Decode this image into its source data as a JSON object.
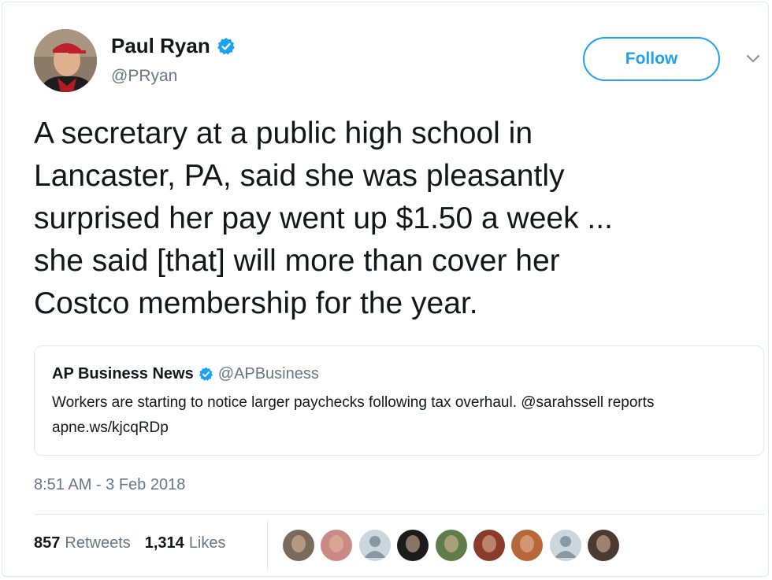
{
  "user": {
    "name": "Paul Ryan",
    "handle": "@PRyan",
    "follow_label": "Follow"
  },
  "tweet": {
    "text": "A secretary at a public high school in\nLancaster, PA, said she was pleasantly\nsurprised her pay went up $1.50 a week ...\nshe said [that] will more than cover her\nCostco membership for the year.",
    "timestamp": "8:51 AM - 3 Feb 2018"
  },
  "quoted": {
    "name": "AP Business News",
    "handle": "@APBusiness",
    "text": "Workers are starting to notice larger paychecks following tax overhaul. @sarahssell reports apne.ws/kjcqRDp"
  },
  "stats": {
    "retweets": "857",
    "retweets_label": "Retweets",
    "likes": "1,314",
    "likes_label": "Likes"
  },
  "likers": [
    {
      "icon": "liker-avatar-photo",
      "color": "#7a6a5c"
    },
    {
      "icon": "liker-avatar-photo",
      "color": "#c98a86"
    },
    {
      "icon": "liker-avatar-default",
      "color": "#ccd6dd"
    },
    {
      "icon": "liker-avatar-photo",
      "color": "#1b1b1b"
    },
    {
      "icon": "liker-avatar-photo",
      "color": "#5f7d4a"
    },
    {
      "icon": "liker-avatar-photo",
      "color": "#8a3b2a"
    },
    {
      "icon": "liker-avatar-photo",
      "color": "#b8673a"
    },
    {
      "icon": "liker-avatar-default",
      "color": "#ccd6dd"
    },
    {
      "icon": "liker-avatar-photo",
      "color": "#4a3a30"
    }
  ],
  "colors": {
    "accent": "#1da1f2",
    "text": "#14171a",
    "muted": "#657786",
    "border": "#e1e8ed"
  }
}
